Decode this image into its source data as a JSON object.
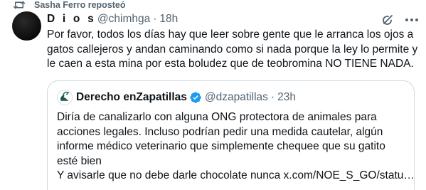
{
  "repost": {
    "label": "Sasha Ferro reposteó",
    "icon": "repost-icon"
  },
  "tweet": {
    "display_name": "D i o s",
    "handle": "@chimhga",
    "separator": "·",
    "time": "18h",
    "text": "Por favor, todos los días hay que leer sobre gente que le arranca los ojos a gatos callejeros y andan caminando como si nada porque la ley lo permite y le caen a esta mina por esta boludez que de teobromina NO TIENE NADA.",
    "actions": [
      "grok-icon",
      "more-icon"
    ]
  },
  "quote": {
    "display_name": "Derecho enZapatillas",
    "verified": true,
    "handle": "@dzapatillas",
    "separator": "·",
    "time": "23h",
    "lines": [
      "Diría de canalizarlo con alguna ONG protectora de animales para acciones legales. Incluso podrían pedir una medida cautelar, algún informe médico veterinario que simplemente chequee que su gatito esté bien",
      "Y avisarle que no debe darle chocolate nunca x.com/NOE_S_GO/statu…"
    ]
  },
  "colors": {
    "text_primary": "#0f1419",
    "text_secondary": "#536471",
    "border": "#cfd9de",
    "verified_blue": "#1d9bf0"
  }
}
